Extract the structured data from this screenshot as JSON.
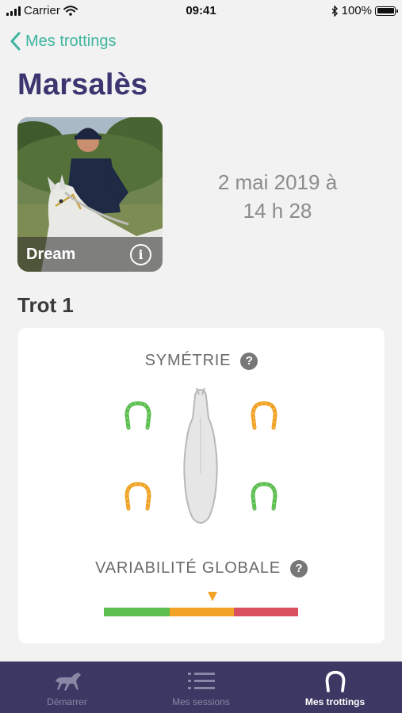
{
  "status_bar": {
    "carrier": "Carrier",
    "time": "09:41",
    "battery": "100%"
  },
  "nav": {
    "back_label": "Mes trottings"
  },
  "page": {
    "title": "Marsalès"
  },
  "photo": {
    "name": "Dream"
  },
  "session": {
    "date_line1": "2 mai 2019 à",
    "date_line2": "14 h 28"
  },
  "trot": {
    "title": "Trot 1",
    "symmetry_label": "SYMÉTRIE",
    "variability_label": "VARIABILITÉ GLOBALE",
    "shoes": [
      {
        "position": "front-left",
        "status": "green"
      },
      {
        "position": "front-right",
        "status": "orange"
      },
      {
        "position": "hind-left",
        "status": "orange"
      },
      {
        "position": "hind-right",
        "status": "green"
      }
    ],
    "variability_level": "orange",
    "variability_fraction": 0.56
  },
  "colors": {
    "accent": "#3fb59f",
    "title": "#3b3570",
    "green": "#5cbf4f",
    "orange": "#f0a326",
    "red": "#d9505e",
    "tab_bar": "#3d3863"
  },
  "tabs": [
    {
      "label": "Démarrer",
      "icon": "horse-icon",
      "active": false
    },
    {
      "label": "Mes sessions",
      "icon": "list-icon",
      "active": false
    },
    {
      "label": "Mes trottings",
      "icon": "horseshoe-icon",
      "active": true
    }
  ]
}
